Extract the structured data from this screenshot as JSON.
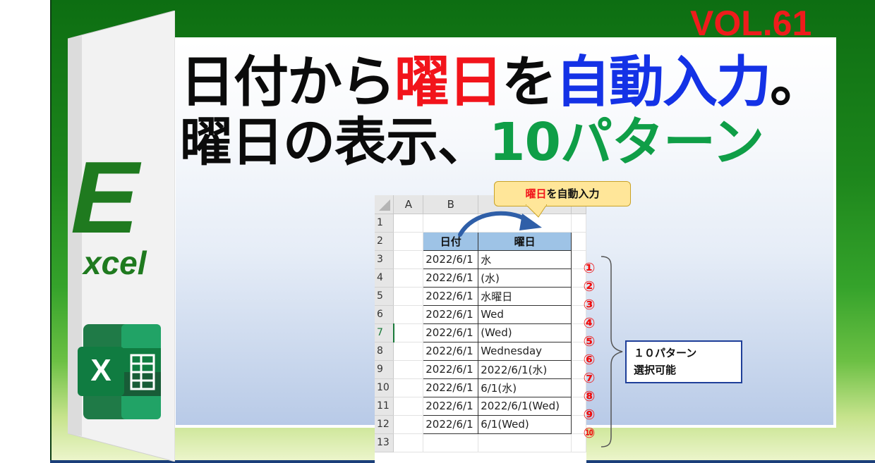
{
  "volume": "VOL.61",
  "title": {
    "line1_a": "日付から",
    "line1_b": "曜日",
    "line1_c": "を",
    "line1_d": "自動入力",
    "line1_e": "。",
    "line2_a": "曜日の表示、",
    "line2_b": "10パターン"
  },
  "logo": {
    "letter": "E",
    "rest": "xcel"
  },
  "callout": {
    "highlight": "曜日",
    "rest": "を自動入力"
  },
  "sheet": {
    "columns": [
      "A",
      "B"
    ],
    "header": {
      "date": "日付",
      "weekday": "曜日"
    },
    "rows": [
      {
        "num": "1",
        "date": "",
        "weekday": ""
      },
      {
        "num": "2",
        "date": "日付",
        "weekday": "曜日"
      },
      {
        "num": "3",
        "date": "2022/6/1",
        "weekday": "水"
      },
      {
        "num": "4",
        "date": "2022/6/1",
        "weekday": "(水)"
      },
      {
        "num": "5",
        "date": "2022/6/1",
        "weekday": "水曜日"
      },
      {
        "num": "6",
        "date": "2022/6/1",
        "weekday": "Wed"
      },
      {
        "num": "7",
        "date": "2022/6/1",
        "weekday": "(Wed)"
      },
      {
        "num": "8",
        "date": "2022/6/1",
        "weekday": "Wednesday"
      },
      {
        "num": "9",
        "date": "2022/6/1",
        "weekday": "2022/6/1(水)"
      },
      {
        "num": "10",
        "date": "2022/6/1",
        "weekday": "6/1(水)"
      },
      {
        "num": "11",
        "date": "2022/6/1",
        "weekday": "2022/6/1(Wed)"
      },
      {
        "num": "12",
        "date": "2022/6/1",
        "weekday": "6/1(Wed)"
      },
      {
        "num": "13",
        "date": "",
        "weekday": ""
      }
    ]
  },
  "markers": [
    "①",
    "②",
    "③",
    "④",
    "⑤",
    "⑥",
    "⑦",
    "⑧",
    "⑨",
    "⑩"
  ],
  "info": {
    "line1": "１０パターン",
    "line2": "選択可能"
  },
  "colors": {
    "red": "#f2141b",
    "blue": "#1432e6",
    "green": "#0f9e47",
    "excel_green": "#1f7a1f",
    "header_fill": "#9ec3e6",
    "callout_fill": "#ffe699"
  }
}
